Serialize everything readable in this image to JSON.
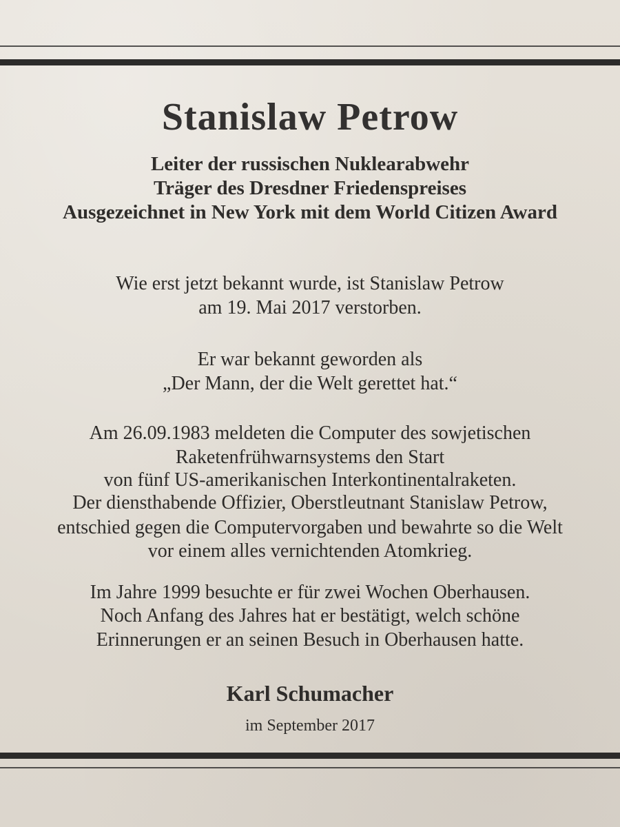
{
  "notice": {
    "name": "Stanislaw Petrow",
    "subtitle": [
      "Leiter der russischen Nuklearabwehr",
      "Träger des Dresdner Friedenspreises",
      "Ausgezeichnet in New York mit dem World Citizen Award"
    ],
    "paragraphs": [
      [
        "Wie erst jetzt bekannt wurde, ist Stanislaw Petrow",
        "am 19. Mai 2017 verstorben."
      ],
      [
        "Er war bekannt geworden als",
        "„Der Mann, der die Welt gerettet hat.“"
      ],
      [
        "Am 26.09.1983 meldeten die Computer des sowjetischen",
        "Raketenfrühwarnsystems den Start",
        "von fünf US-amerikanischen Interkontinentalraketen.",
        "Der diensthabende Offizier, Oberstleutnant Stanislaw Petrow,",
        "entschied gegen die Computervorgaben und bewahrte so die Welt",
        "vor einem alles vernichtenden Atomkrieg."
      ],
      [
        "Im Jahre 1999 besuchte er für zwei Wochen Oberhausen.",
        "Noch Anfang des Jahres hat er bestätigt, welch schöne",
        "Erinnerungen er an seinen Besuch in Oberhausen hatte."
      ]
    ],
    "signature": "Karl Schumacher",
    "date": "im September 2017"
  }
}
